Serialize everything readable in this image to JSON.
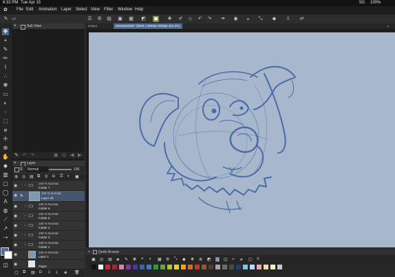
{
  "status_bar": {
    "time": "6:32 PM",
    "date": "Tue Apr 15",
    "network": "5G",
    "battery": "100%"
  },
  "menu": {
    "items": [
      "File",
      "Edit",
      "Animation",
      "Layer",
      "Select",
      "View",
      "Filter",
      "Window",
      "Help"
    ]
  },
  "sub_view": {
    "title": "Sub View"
  },
  "layer_panel": {
    "title": "Layer",
    "blend_mode": "Normal",
    "opacity": "100",
    "layers": [
      {
        "l1": "100 % Normal",
        "l2": "Folder 7",
        "kind": "folder"
      },
      {
        "l1": "100 % Normal",
        "l2": "Layer 26",
        "kind": "layer",
        "selected": true
      },
      {
        "l1": "100 % Normal",
        "l2": "Folder 6",
        "kind": "folder"
      },
      {
        "l1": "100 % Normal",
        "l2": "Folder 5",
        "kind": "folder"
      },
      {
        "l1": "100 % Normal",
        "l2": "Folder 3",
        "kind": "folder"
      },
      {
        "l1": "100 % Normal",
        "l2": "Folder 2",
        "kind": "folder"
      },
      {
        "l1": "100 % Normal",
        "l2": "Folder 1",
        "kind": "folder"
      },
      {
        "l1": "100 % Normal",
        "l2": "Layer 1",
        "kind": "pic"
      },
      {
        "l1": "",
        "l2": "Paper",
        "kind": "paper"
      }
    ]
  },
  "doc_tabs": [
    {
      "label": "sciqe4",
      "active": false
    },
    {
      "label": "idontwant325* (3840 x 3840px 300dpi 261.2%)",
      "active": true
    }
  ],
  "quick_access": {
    "title": "Quick Access",
    "swatch_colors": [
      "#111111",
      "#ffffff",
      "#d8252a",
      "#b01e2f",
      "#e07bb0",
      "#7c3aa1",
      "#3d3d9e",
      "#3f5fb5",
      "#3c7ec1",
      "#2e9c3a",
      "#63a83c",
      "#a6c83a",
      "#e9d02b",
      "#f0a21f",
      "#e0662a",
      "#c73a28",
      "#8a5a3c",
      "#5b3a2a",
      "#a5a5a5",
      "#6e6e6e",
      "#4a4a4a",
      "#223a7a",
      "#7bc6e8",
      "#b9ddf0",
      "#e8a8b0",
      "#f4d9a3",
      "#f2f2c8",
      "#c9c9c9"
    ]
  },
  "colors": {
    "canvas": "#a8b8cc",
    "sketch": "#4a6aa8",
    "accent": "#4a6a92"
  }
}
